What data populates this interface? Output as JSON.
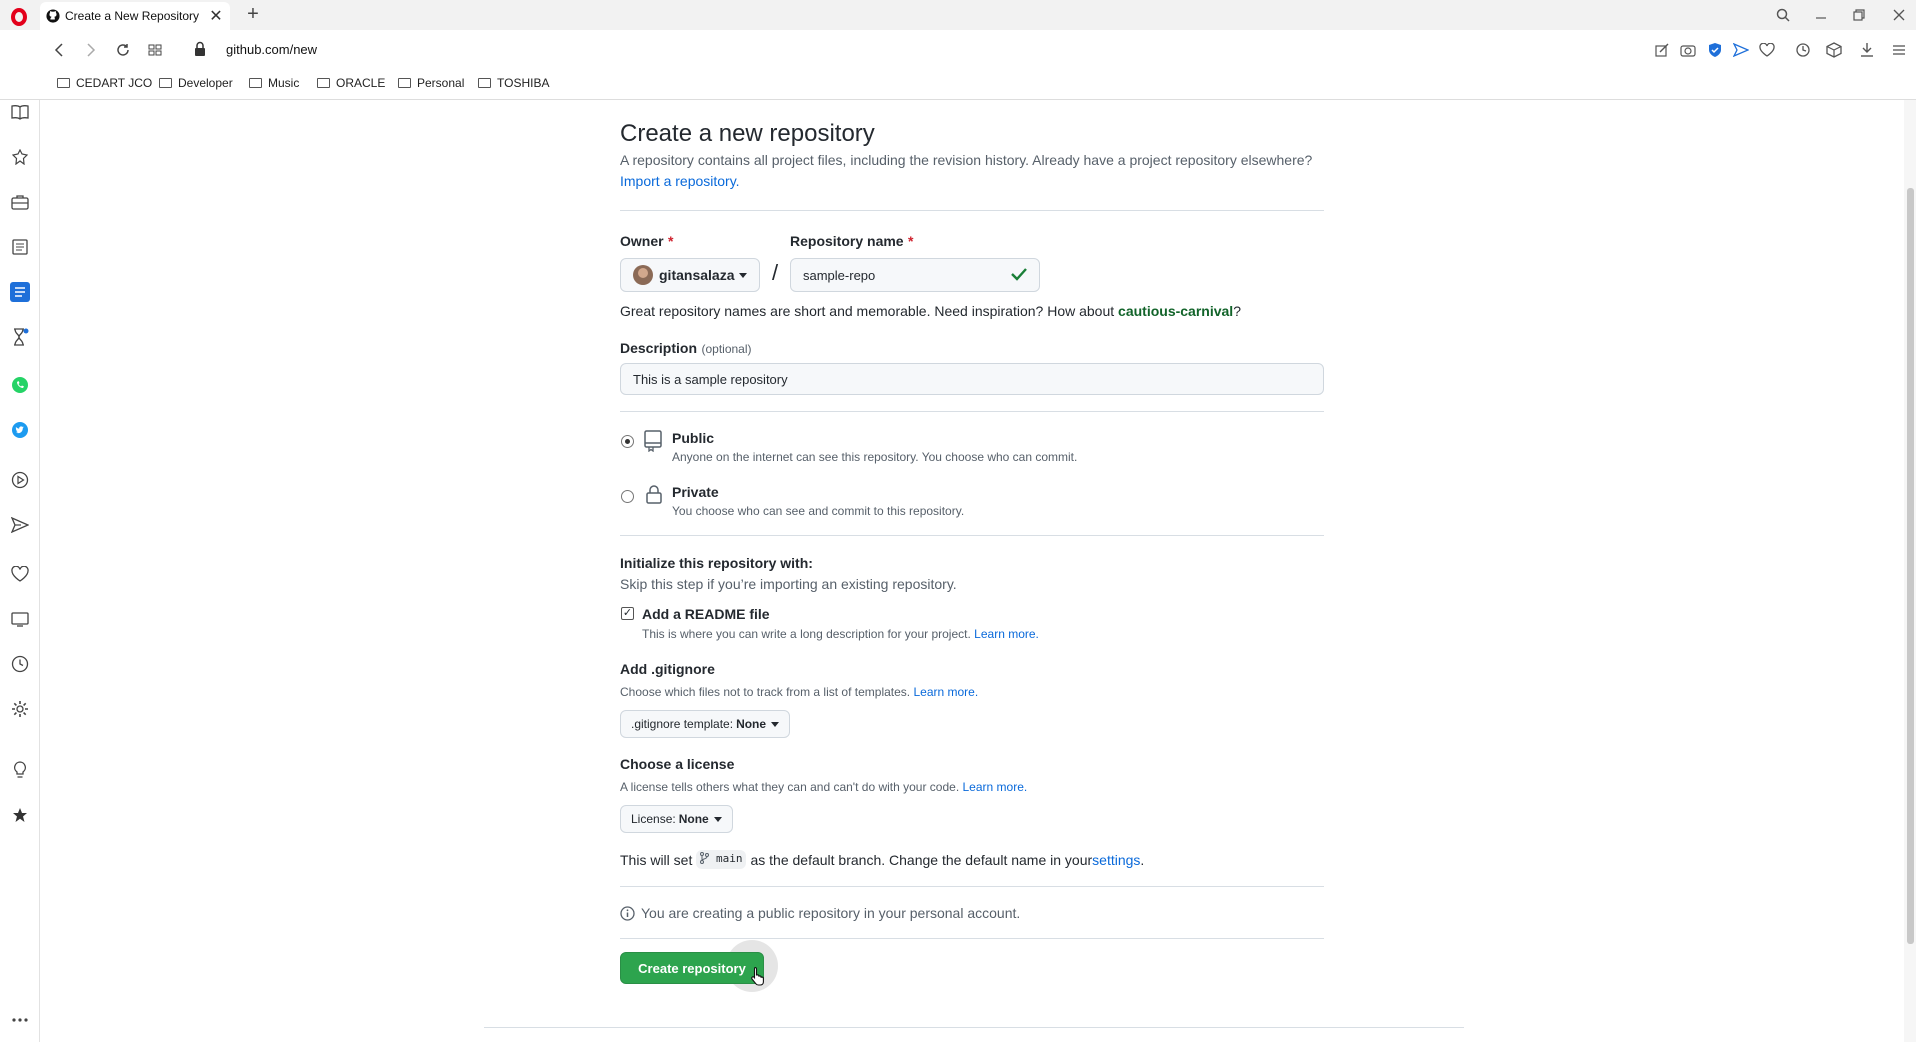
{
  "browser": {
    "tab_title": "Create a New Repository",
    "url": "github.com/new",
    "bookmarks": [
      "CEDART JCO",
      "Developer",
      "Music",
      "ORACLE",
      "Personal",
      "TOSHIBA"
    ]
  },
  "page": {
    "title": "Create a new repository",
    "subtitle": "A repository contains all project files, including the revision history. Already have a project repository elsewhere?",
    "import_link": "Import a repository.",
    "owner_label": "Owner",
    "required_mark": "*",
    "owner_value": "gitansalaza",
    "separator": "/",
    "repo_name_label": "Repository name",
    "repo_name_value": "sample-repo",
    "suggestion_prefix": "Great repository names are short and memorable. Need inspiration? How about ",
    "suggestion_name": "cautious-carnival",
    "suggestion_suffix": "?",
    "description_label": "Description",
    "description_optional": "(optional)",
    "description_value": "This is a sample repository",
    "visibility": {
      "public_label": "Public",
      "public_desc": "Anyone on the internet can see this repository. You choose who can commit.",
      "private_label": "Private",
      "private_desc": "You choose who can see and commit to this repository.",
      "selected": "public"
    },
    "init": {
      "heading": "Initialize this repository with:",
      "sub": "Skip this step if you’re importing an existing repository.",
      "readme_label": "Add a README file",
      "readme_checked": true,
      "readme_desc": "This is where you can write a long description for your project.",
      "learn_more": "Learn more.",
      "gitignore_heading": "Add .gitignore",
      "gitignore_desc": "Choose which files not to track from a list of templates.",
      "gitignore_btn_prefix": ".gitignore template: ",
      "gitignore_btn_value": "None",
      "license_heading": "Choose a license",
      "license_desc": "A license tells others what they can and can't do with your code.",
      "license_btn_prefix": "License: ",
      "license_btn_value": "None"
    },
    "branch": {
      "prefix": "This will set ",
      "name": "main",
      "middle": " as the default branch. Change the default name in your ",
      "link": "settings",
      "suffix": "."
    },
    "info_note": "You are creating a public repository in your personal account.",
    "create_button": "Create repository"
  },
  "colors": {
    "primary_button": "#2da44e",
    "link": "#0969da",
    "suggestion": "#116329",
    "check": "#1a7f37",
    "required": "#cf222e"
  }
}
